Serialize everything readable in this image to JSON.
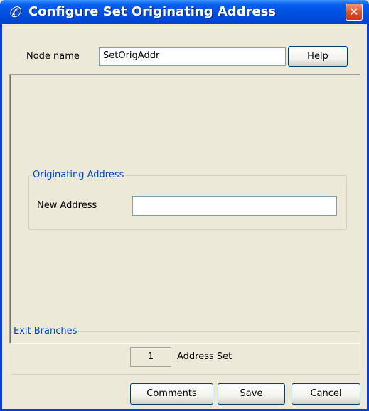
{
  "window": {
    "title": "Configure Set Originating Address",
    "icon": "phone-handset-icon",
    "close_glyph": "✕",
    "title_bar_color": "#0054e3"
  },
  "node": {
    "label": "Node name",
    "value": "SetOrigAddr",
    "help_label": "Help"
  },
  "originating_address": {
    "legend": "Originating Address",
    "new_address_label": "New Address",
    "new_address_value": ""
  },
  "exit_branches": {
    "legend": "Exit Branches",
    "branches": [
      {
        "number": "1",
        "label": "Address Set"
      }
    ]
  },
  "footer": {
    "comments_label": "Comments",
    "save_label": "Save",
    "cancel_label": "Cancel"
  },
  "colors": {
    "group_legend": "#0046d5",
    "background": "#ece9d8",
    "close_button": "#e0502a"
  }
}
